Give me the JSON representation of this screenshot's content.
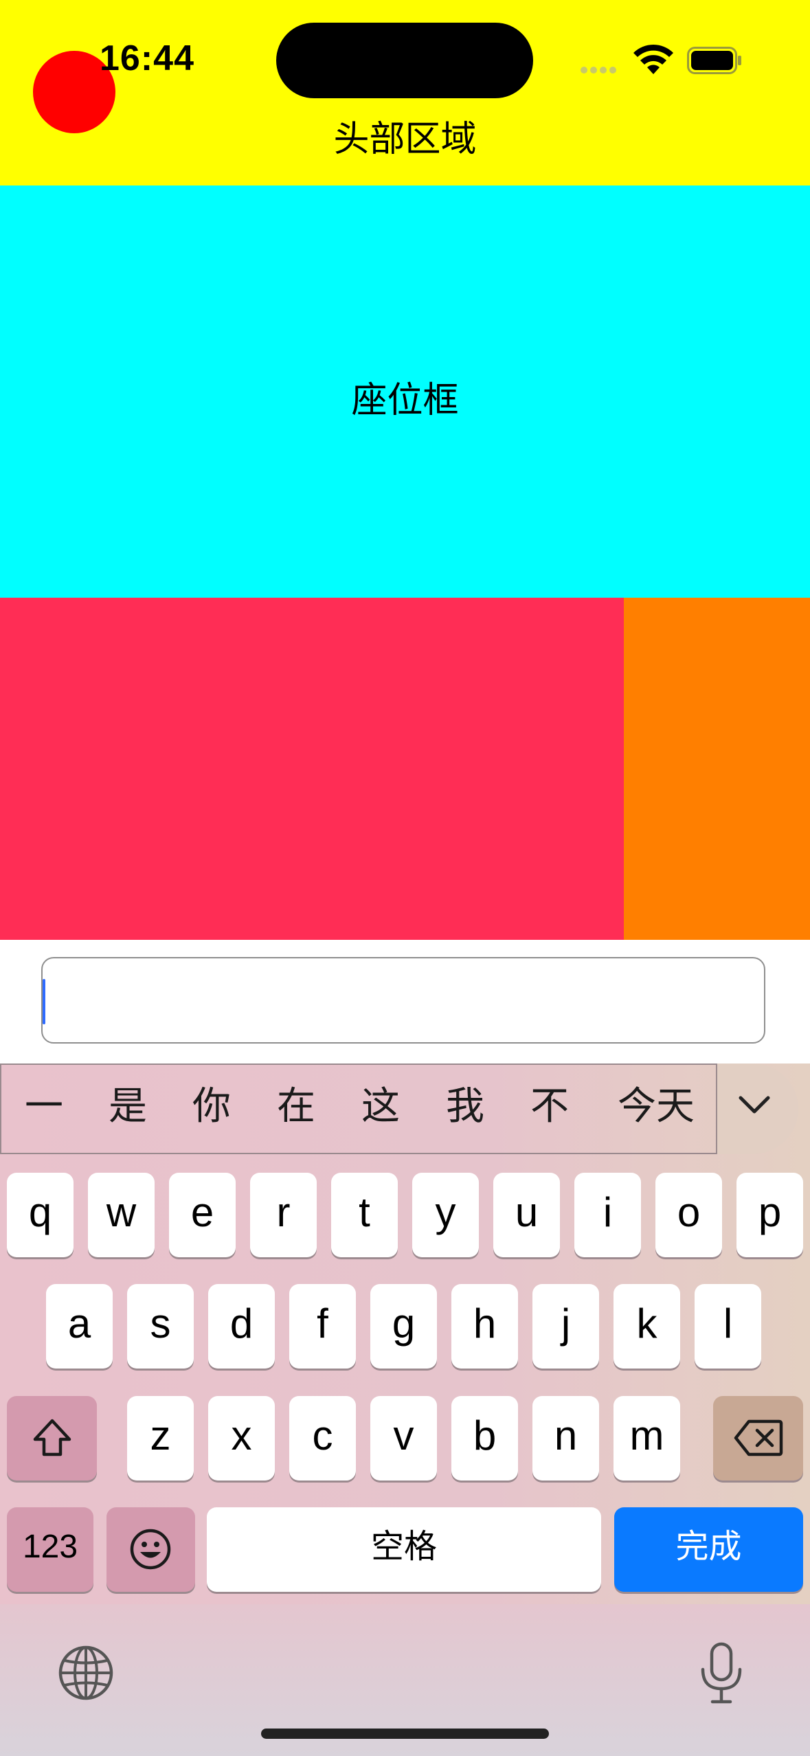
{
  "status_bar": {
    "time": "16:44",
    "icons": [
      "signal-dots-icon",
      "wifi-icon",
      "battery-icon"
    ]
  },
  "header": {
    "title": "头部区域",
    "bg_color": "#ffff00"
  },
  "seat_box": {
    "label": "座位框",
    "bg_color": "#00ffff"
  },
  "panels": {
    "left_color": "#ff2d55",
    "right_color": "#ff7f00"
  },
  "input": {
    "value": "",
    "placeholder": ""
  },
  "keyboard": {
    "candidates": [
      "一",
      "是",
      "你",
      "在",
      "这",
      "我",
      "不",
      "今天"
    ],
    "row1": [
      "q",
      "w",
      "e",
      "r",
      "t",
      "y",
      "u",
      "i",
      "o",
      "p"
    ],
    "row2": [
      "a",
      "s",
      "d",
      "f",
      "g",
      "h",
      "j",
      "k",
      "l"
    ],
    "row3": [
      "z",
      "x",
      "c",
      "v",
      "b",
      "n",
      "m"
    ],
    "numbers_label": "123",
    "space_label": "空格",
    "done_label": "完成",
    "done_color": "#0a7aff"
  }
}
